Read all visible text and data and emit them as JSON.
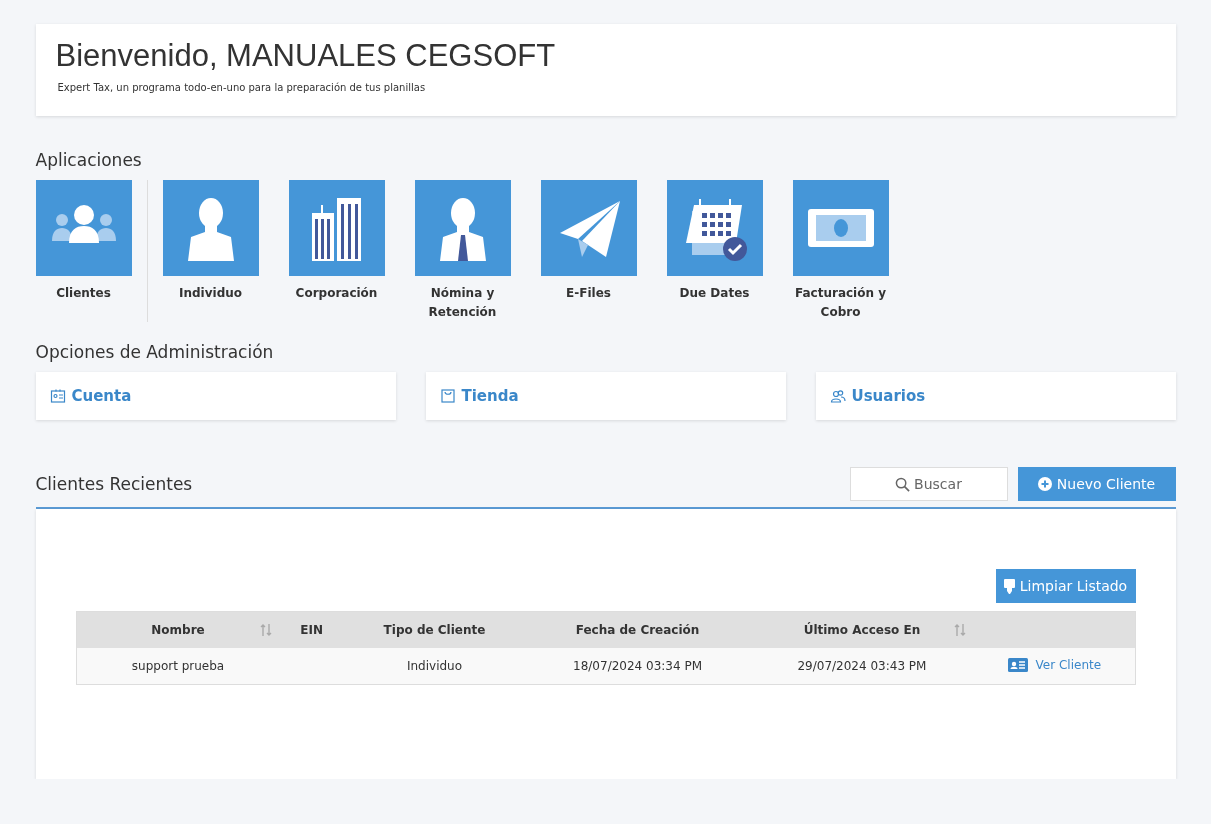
{
  "header": {
    "title": "Bienvenido, MANUALES CEGSOFT",
    "subtitle": "Expert Tax, un programa todo-en-uno para la preparación de tus planillas"
  },
  "applications": {
    "title": "Aplicaciones",
    "items": [
      {
        "label": "Clientes",
        "kind": "clients"
      },
      {
        "label": "Individuo",
        "kind": "individual"
      },
      {
        "label": "Corporación",
        "kind": "corporation"
      },
      {
        "label": "Nómina y Retención",
        "kind": "payroll"
      },
      {
        "label": "E-Files",
        "kind": "efiles"
      },
      {
        "label": "Due Dates",
        "kind": "calendar"
      },
      {
        "label": "Facturación y Cobro",
        "kind": "billing"
      }
    ]
  },
  "admin_options": {
    "title": "Opciones de Administración",
    "items": [
      {
        "label": "Cuenta",
        "kind": "account"
      },
      {
        "label": "Tienda",
        "kind": "store"
      },
      {
        "label": "Usuarios",
        "kind": "users"
      }
    ]
  },
  "recent_clients": {
    "title": "Clientes Recientes",
    "search_button": "Buscar",
    "new_button": "Nuevo Cliente",
    "clear_button": "Limpiar Listado",
    "table": {
      "columns": [
        {
          "label": "Nombre",
          "sortable": true
        },
        {
          "label": "EIN",
          "sortable": false
        },
        {
          "label": "Tipo de Cliente",
          "sortable": false
        },
        {
          "label": "Fecha de Creación",
          "sortable": false
        },
        {
          "label": "Último Acceso En",
          "sortable": true
        },
        {
          "sortable": false
        }
      ],
      "rows": [
        {
          "cells": [
            "support prueba",
            "",
            "Individuo",
            "18/07/2024 03:34 PM",
            "29/07/2024 03:43 PM"
          ],
          "action": "Ver Cliente"
        }
      ]
    }
  }
}
